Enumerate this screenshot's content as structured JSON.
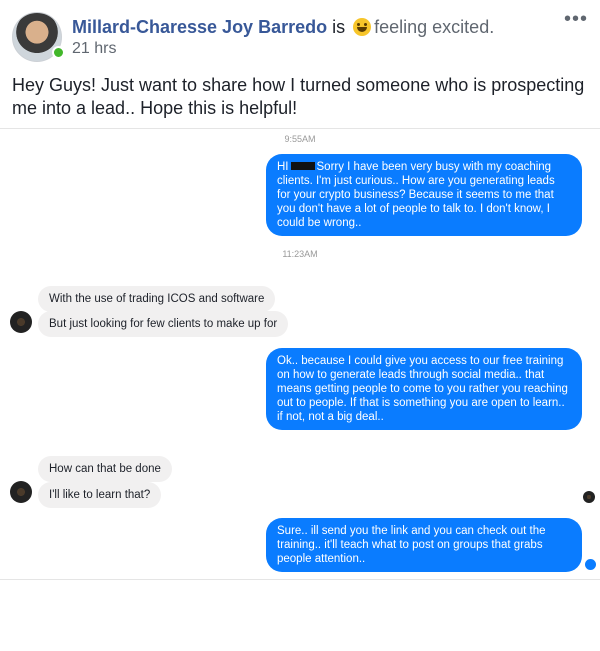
{
  "post": {
    "author": "Millard-Charesse Joy Barredo",
    "is_text": "is",
    "feeling_icon": "grinning-emoji",
    "feeling": "feeling excited.",
    "time": "21 hrs",
    "menu_icon": "more-dots-icon",
    "body": "Hey Guys! Just want to share how I turned someone who is prospecting me into a lead.. Hope this is helpful!"
  },
  "chat": {
    "timestamp1": "9:55AM",
    "msg1_pre": "HI",
    "msg1_post": "Sorry I have been very busy with my coaching clients.  I'm just curious..  How are you generating leads for your crypto business?  Because it seems to me that you don't have a lot of people to talk to.  I  don't know,  I could be wrong..",
    "timestamp2": "11:23AM",
    "msg2": "With the use of trading ICOS and software",
    "msg3": "But just looking for few clients to make up for",
    "msg4": "Ok.. because I could give you access to our free training on how to generate leads through social media.. that means getting people to come to you rather you reaching out to people.  If that is something you are open to learn.. if not, not a big deal..",
    "msg5": "How can that be done",
    "msg6": "I'll like to learn that?",
    "msg7": "Sure.. ill send you the link and you can check out the training..   it'll teach what to post on groups that grabs people attention..",
    "colors": {
      "outgoing": "#0a7cff",
      "incoming": "#f1f0f0"
    }
  }
}
